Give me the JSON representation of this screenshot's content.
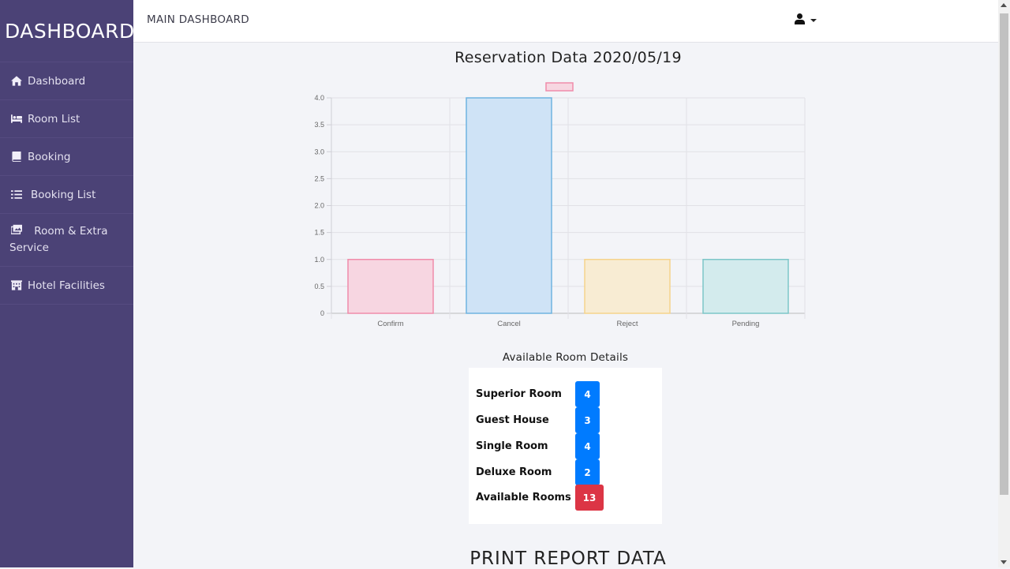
{
  "brand": "DASHBOARD",
  "sidebar": {
    "items": [
      {
        "label": "Dashboard",
        "icon": "home-icon"
      },
      {
        "label": "Room List",
        "icon": "bed-icon"
      },
      {
        "label": "Booking",
        "icon": "book-icon"
      },
      {
        "label": "Booking List",
        "icon": "list-icon"
      },
      {
        "label": "Room & Extra",
        "label2": "Service",
        "icon": "images-icon"
      },
      {
        "label": "Hotel Facilities",
        "icon": "building-icon"
      }
    ]
  },
  "header": {
    "title": "MAIN DASHBOARD",
    "user_icon": "user-icon"
  },
  "chart_data": {
    "type": "bar",
    "title": "Reservation Data 2020/05/19",
    "categories": [
      "Confirm",
      "Cancel",
      "Reject",
      "Pending"
    ],
    "values": [
      1,
      4,
      1,
      1
    ],
    "ylim": [
      0,
      4
    ],
    "yticks": [
      "0",
      "0.5",
      "1.0",
      "1.5",
      "2.0",
      "2.5",
      "3.0",
      "3.5",
      "4.0"
    ],
    "grid": true,
    "legend": "top",
    "fill_colors": [
      "#f7d6e1",
      "#cfe3f6",
      "#f8ecd3",
      "#d3ebed"
    ],
    "stroke_colors": [
      "#f08caa",
      "#6fb3e0",
      "#f6d38c",
      "#7cc6c8"
    ]
  },
  "rooms": {
    "heading": "Available Room Details",
    "items": [
      {
        "label": "Superior Room",
        "count": "4",
        "status": "#007bff"
      },
      {
        "label": "Guest House",
        "count": "3",
        "status": "#007bff"
      },
      {
        "label": "Single Room",
        "count": "4",
        "status": "#007bff"
      },
      {
        "label": "Deluxe Room",
        "count": "2",
        "status": "#007bff"
      },
      {
        "label": "Available Rooms",
        "count": "13",
        "status": "#dc3545"
      }
    ]
  },
  "print_heading": "PRINT REPORT DATA"
}
